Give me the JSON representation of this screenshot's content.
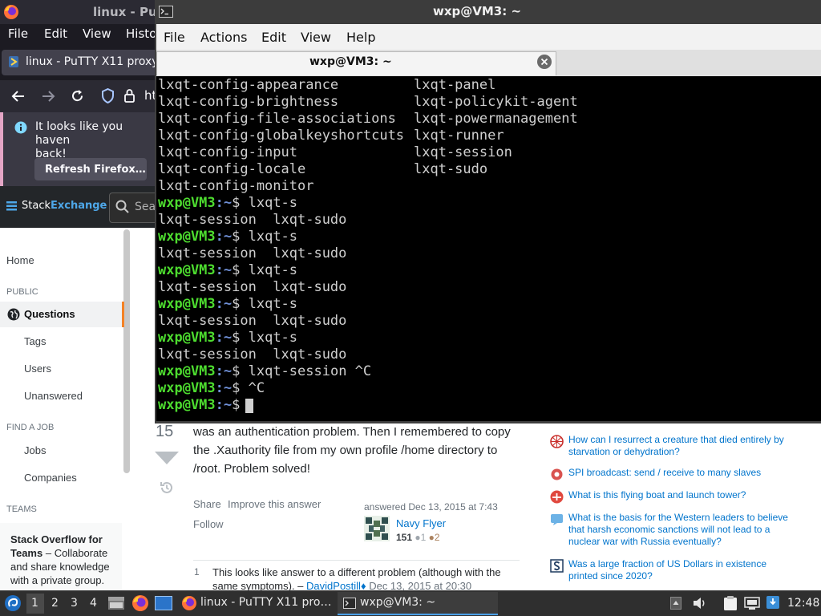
{
  "firefox": {
    "title": "linux - Pu",
    "menu": [
      "File",
      "Edit",
      "View",
      "Histo"
    ],
    "tab_label": "linux - PuTTY X11 proxy",
    "address_partial": "ht",
    "notice": "It looks like you haven back!",
    "notice_line1": "It looks like you haven",
    "notice_line2": "back!",
    "refresh_button": "Refresh Firefox…"
  },
  "stackexchange": {
    "logo_plain": "Stack",
    "logo_bold": "Exchange",
    "search_label": "Sea"
  },
  "nav": {
    "home": "Home",
    "public_heading": "PUBLIC",
    "questions": "Questions",
    "tags": "Tags",
    "users": "Users",
    "unanswered": "Unanswered",
    "find_job_heading": "FIND A JOB",
    "jobs": "Jobs",
    "companies": "Companies",
    "teams_heading": "TEAMS",
    "teams_title": "Stack Overflow for Teams",
    "teams_desc": " – Collaborate and share knowledge with a private group."
  },
  "answer": {
    "votes": "15",
    "text": "was an authentication problem. Then I remembered to copy the .Xauthority file from my own profile /home directory to /root. Problem solved!",
    "share": "Share",
    "improve": "Improve this answer",
    "follow": "Follow",
    "answered": "answered Dec 13, 2015 at 7:43",
    "user_name": "Navy Flyer",
    "rep": "151",
    "silver": "●1",
    "bronze": "●2"
  },
  "comment": {
    "number": "1",
    "text": "This looks like answer to a different problem (although with the same symptoms). – ",
    "user": "DavidPostill",
    "diamond": "♦",
    "date": " Dec 13, 2015 at 20:30"
  },
  "hot_questions": [
    "How can I resurrect a creature that died entirely by starvation or dehydration?",
    "SPI broadcast: send / receive to many slaves",
    "What is this flying boat and launch tower?",
    "What is the basis for the Western leaders to believe that harsh economic sanctions will not lead to a nuclear war with Russia eventually?",
    "Was a large fraction of US Dollars in existence printed since 2020?"
  ],
  "terminal": {
    "window_title": "wxp@VM3: ~",
    "menu": [
      "File",
      "Actions",
      "Edit",
      "View",
      "Help"
    ],
    "tab_title": "wxp@VM3: ~",
    "prompt_user": "wxp@VM3",
    "prompt_path": ":~",
    "completions_col1": [
      "lxqt-config-appearance",
      "lxqt-config-brightness",
      "lxqt-config-file-associations",
      "lxqt-config-globalkeyshortcuts",
      "lxqt-config-input",
      "lxqt-config-locale",
      "lxqt-config-monitor"
    ],
    "completions_col2": [
      "lxqt-panel",
      "lxqt-policykit-agent",
      "lxqt-powermanagement",
      "lxqt-runner",
      "lxqt-session",
      "lxqt-sudo"
    ],
    "cmd": "$ lxqt-s",
    "result": "lxqt-session  lxqt-sudo",
    "cmd_final": "$ lxqt-session ^C",
    "cmd_ctrlc": "$ ^C",
    "cmd_empty": "$ "
  },
  "taskbar": {
    "workspaces": [
      "1",
      "2",
      "3",
      "4"
    ],
    "task_firefox": "linux - PuTTY X11 pro…",
    "task_terminal": "wxp@VM3: ~",
    "clock": "12:48"
  },
  "colors": {
    "prompt_green": "#4ddc2f",
    "prompt_blue": "#6f8fd6",
    "accent_orange": "#f48225",
    "link_blue": "#0074cc"
  }
}
